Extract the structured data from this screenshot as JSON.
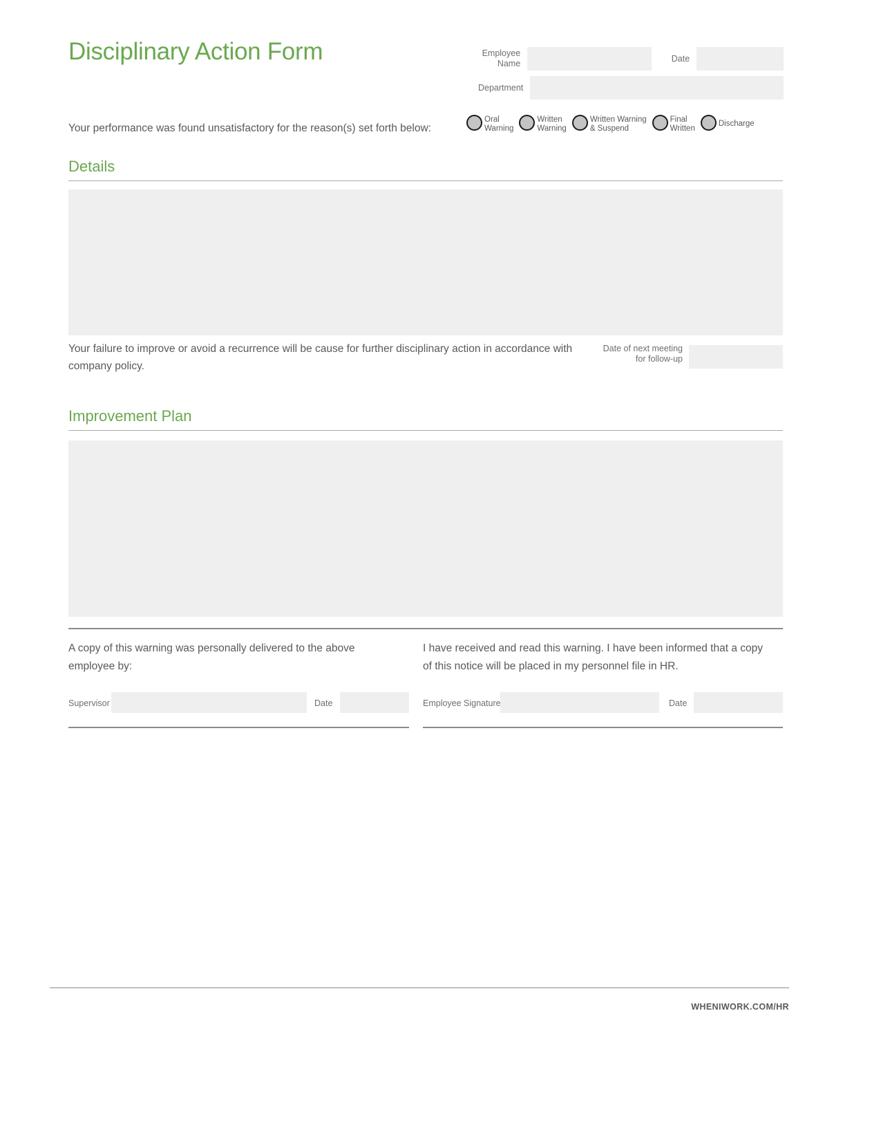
{
  "document": {
    "title": "Disciplinary Action Form",
    "intro": "Your performance was found unsatisfactory for the reason(s) set forth below:"
  },
  "employee_fields": {
    "employee_name_label": "Employee\nName",
    "employee_name_value": "",
    "date_label": "Date",
    "date_value": "",
    "department_label": "Department",
    "department_value": ""
  },
  "action_options": [
    {
      "id": "oral-warning",
      "label": "Oral\nWarning",
      "selected": false
    },
    {
      "id": "written-warning",
      "label": "Written\nWarning",
      "selected": false
    },
    {
      "id": "written-warning-suspend",
      "label": "Written Warning\n& Suspend",
      "selected": false
    },
    {
      "id": "final-written",
      "label": "Final\nWritten",
      "selected": false
    },
    {
      "id": "discharge",
      "label": "Discharge",
      "selected": false
    }
  ],
  "details_section": {
    "heading": "Details",
    "textarea_value": "",
    "note": "Your failure to improve or avoid a recurrence will be cause for further disciplinary action in accordance with company policy.",
    "followup_label": "Date of next meeting\nfor follow-up",
    "followup_value": ""
  },
  "improvement_section": {
    "heading": "Improvement Plan",
    "textarea_value": ""
  },
  "signatures": {
    "left_statement": "A copy of this warning was personally delivered to the above employee by:",
    "right_statement": "I have received and read this warning. I have been informed that a copy of this notice will be placed in my personnel file in HR.",
    "supervisor_label": "Supervisor",
    "supervisor_value": "",
    "supervisor_date_label": "Date",
    "supervisor_date_value": "",
    "employee_signature_label": "Employee Signature",
    "employee_signature_value": "",
    "employee_date_label": "Date",
    "employee_date_value": ""
  },
  "footer": {
    "brand": "WHENIWORK.COM/HR"
  },
  "colors": {
    "accent_green": "#6aa84f",
    "field_fill": "#efefef",
    "body_text": "#58595b"
  }
}
